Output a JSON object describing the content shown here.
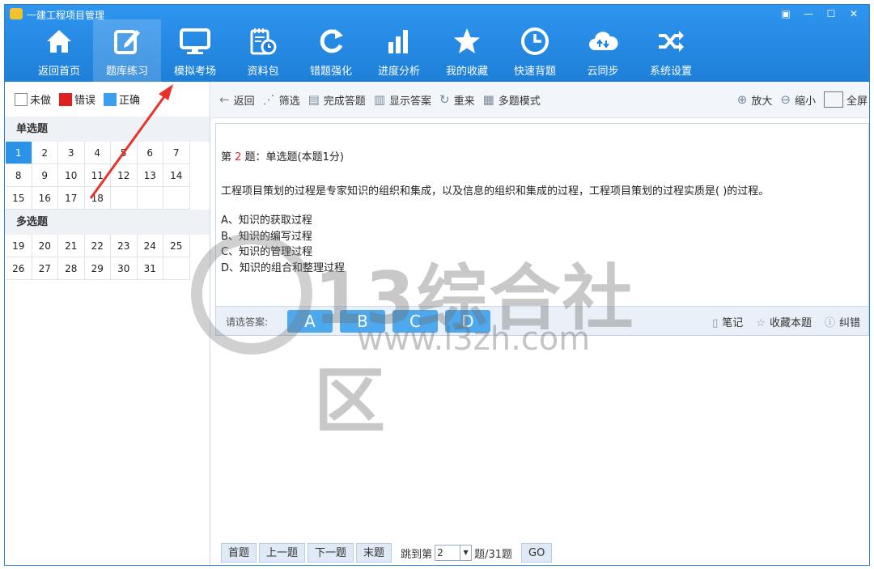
{
  "app": {
    "title": "一建工程项目管理"
  },
  "window_controls": [
    "▣",
    "—",
    "☐",
    "✕"
  ],
  "toolbar": {
    "items": [
      {
        "label": "返回首页",
        "icon": "home-icon"
      },
      {
        "label": "题库练习",
        "icon": "edit-icon"
      },
      {
        "label": "模拟考场",
        "icon": "monitor-icon"
      },
      {
        "label": "资料包",
        "icon": "notebook-clock-icon"
      },
      {
        "label": "错题强化",
        "icon": "refresh-icon"
      },
      {
        "label": "进度分析",
        "icon": "bar-chart-icon"
      },
      {
        "label": "我的收藏",
        "icon": "star-icon"
      },
      {
        "label": "快速背题",
        "icon": "clock-icon"
      },
      {
        "label": "云同步",
        "icon": "cloud-sync-icon"
      },
      {
        "label": "系统设置",
        "icon": "shuffle-icon"
      }
    ],
    "active": "题库练习"
  },
  "legend": {
    "undone": "未做",
    "wrong": "错误",
    "correct": "正确",
    "colors": {
      "undone": "#ffffff",
      "wrong": "#e02020",
      "correct": "#3aa0ec"
    }
  },
  "sections": [
    {
      "title": "单选题",
      "questions": [
        "1",
        "2",
        "3",
        "4",
        "5",
        "6",
        "7",
        "8",
        "9",
        "10",
        "11",
        "12",
        "13",
        "14",
        "15",
        "16",
        "17",
        "18"
      ],
      "current": "1"
    },
    {
      "title": "多选题",
      "questions": [
        "19",
        "20",
        "21",
        "22",
        "23",
        "24",
        "25",
        "26",
        "27",
        "28",
        "29",
        "30",
        "31"
      ]
    }
  ],
  "actions": {
    "back": "返回",
    "filter": "筛选",
    "finish": "完成答题",
    "show_answer": "显示答案",
    "restart": "重来",
    "multi_mode": "多题模式",
    "zoom_in": "放大",
    "zoom_out": "缩小",
    "fullscreen": "全屏"
  },
  "question": {
    "prefix": "第 ",
    "number": "2",
    "suffix": " 题：单选题(本题1分)",
    "text": "工程项目策划的过程是专家知识的组织和集成，以及信息的组织和集成的过程，工程项目策划的过程实质是( )的过程。",
    "options": [
      "A、知识的获取过程",
      "B、知识的编写过程",
      "C、知识的管理过程",
      "D、知识的组合和整理过程"
    ]
  },
  "answer_bar": {
    "label": "请选答案:",
    "choices": [
      "A",
      "B",
      "C",
      "D"
    ],
    "note": "笔记",
    "favorite": "收藏本题",
    "report": "纠错"
  },
  "pagination": {
    "first": "首题",
    "prev": "上一题",
    "next": "下一题",
    "last": "末题",
    "jump_prefix": "跳到第",
    "jump_value": "2",
    "total": "题/31题",
    "go": "GO"
  },
  "watermark": {
    "text": "13综合社区",
    "url": "www.l3zh.com"
  },
  "accent_colors": {
    "header": "#1d7fd8",
    "current_cell": "#2a93e8",
    "answer_button": "#4da8ee",
    "arrow": "#e8332a"
  }
}
